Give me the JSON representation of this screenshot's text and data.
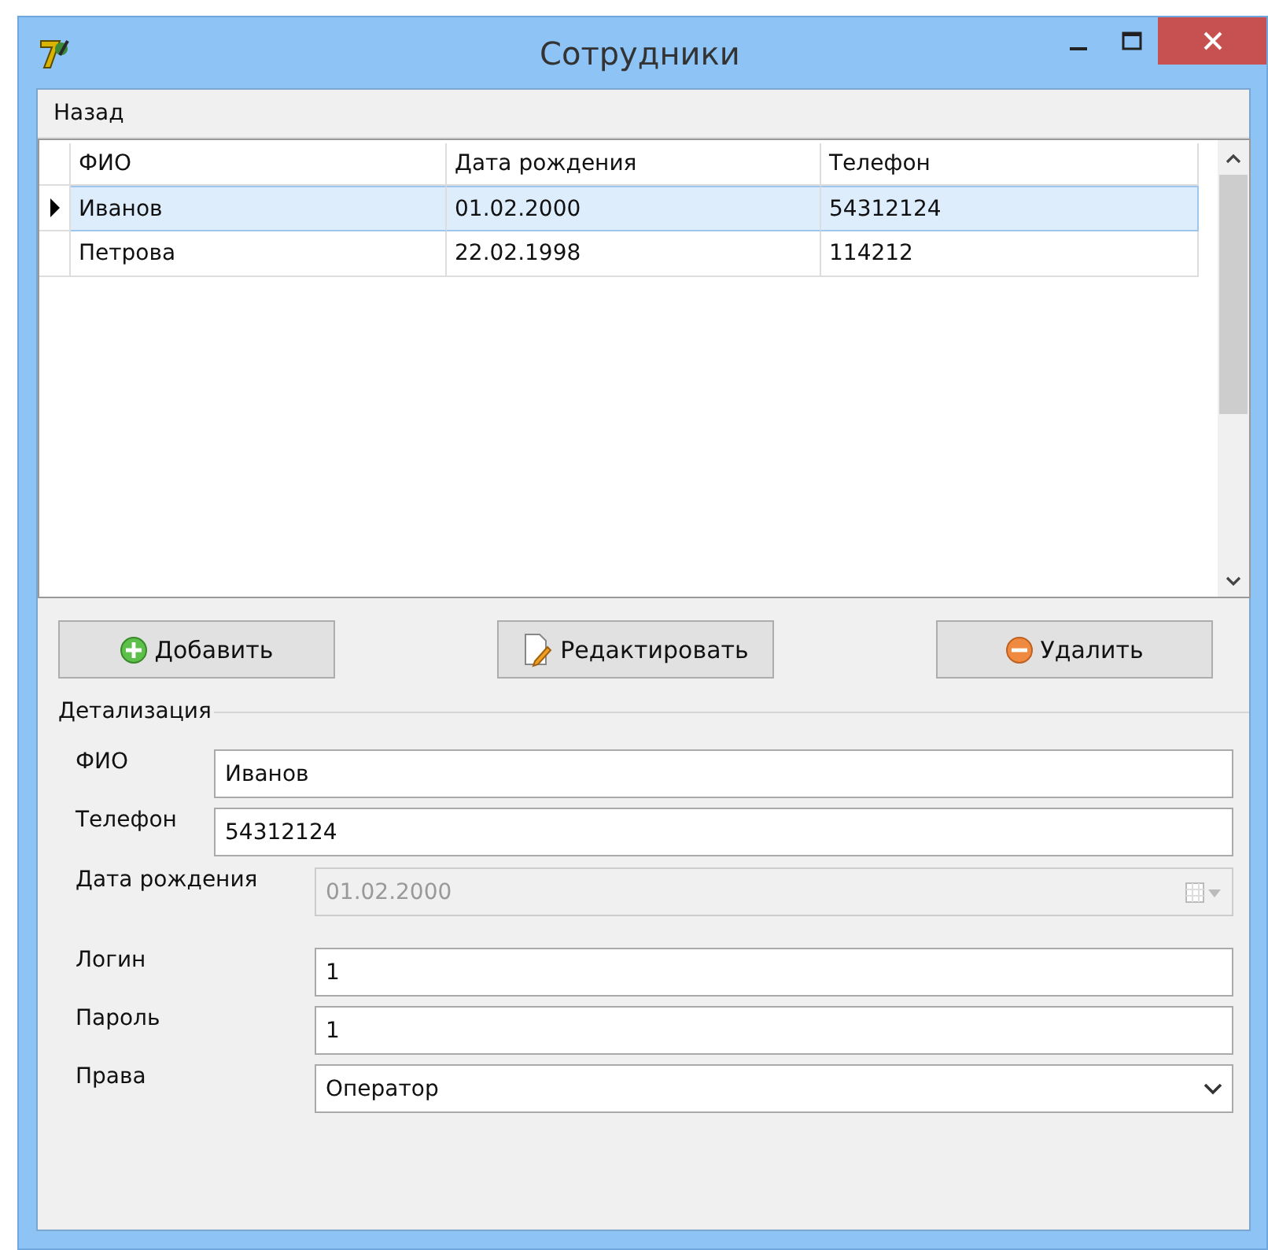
{
  "window": {
    "title": "Сотрудники"
  },
  "menu": [
    "Назад"
  ],
  "table": {
    "columns": [
      "ФИО",
      "Дата рождения",
      "Телефон"
    ],
    "rows": [
      {
        "cells": [
          "Иванов",
          "01.02.2000",
          "54312124"
        ],
        "selected": true
      },
      {
        "cells": [
          "Петрова",
          "22.02.1998",
          "114212"
        ],
        "selected": false
      }
    ]
  },
  "buttons": [
    {
      "label": "Добавить",
      "kind": "add"
    },
    {
      "label": "Редактировать",
      "kind": "edit"
    },
    {
      "label": "Удалить",
      "kind": "delete"
    }
  ],
  "details": {
    "title": "Детализация",
    "groups": [
      [
        {
          "label": "ФИО",
          "value": "Иванов",
          "kind": "text",
          "disabled": false
        },
        {
          "label": "Телефон",
          "value": "54312124",
          "kind": "text",
          "disabled": false
        }
      ],
      [
        {
          "label": "Дата рождения",
          "value": "01.02.2000",
          "kind": "date",
          "disabled": true
        },
        {
          "label": "Логин",
          "value": "1",
          "kind": "text",
          "disabled": false
        },
        {
          "label": "Пароль",
          "value": "1",
          "kind": "text",
          "disabled": false
        },
        {
          "label": "Права",
          "value": "Оператор",
          "kind": "combo",
          "disabled": false
        }
      ]
    ]
  }
}
